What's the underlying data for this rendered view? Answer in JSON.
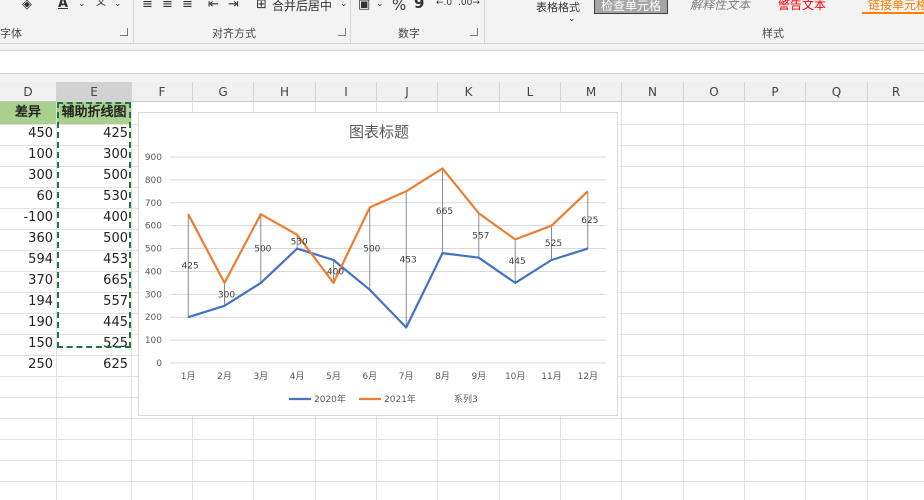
{
  "ribbon": {
    "font_group_label": "字体",
    "align_group_label": "对齐方式",
    "number_group_label": "数字",
    "styles_group_label": "样式",
    "merge_center_label": "合并后居中",
    "table_format_label": "表格格式",
    "percent_label": "%",
    "comma_label": "9",
    "style_items": [
      "检查单元格",
      "解释性文本",
      "警告文本",
      "链接单元格"
    ]
  },
  "columns": [
    "D",
    "E",
    "F",
    "G",
    "H",
    "I",
    "J",
    "K",
    "L",
    "M",
    "N",
    "O",
    "P",
    "Q",
    "R"
  ],
  "table": {
    "header_d": "差异",
    "header_e": "辅助折线图",
    "rows": [
      {
        "d": "450",
        "e": "425"
      },
      {
        "d": "100",
        "e": "300"
      },
      {
        "d": "300",
        "e": "500"
      },
      {
        "d": "60",
        "e": "530"
      },
      {
        "d": "-100",
        "e": "400"
      },
      {
        "d": "360",
        "e": "500"
      },
      {
        "d": "594",
        "e": "453"
      },
      {
        "d": "370",
        "e": "665"
      },
      {
        "d": "194",
        "e": "557"
      },
      {
        "d": "190",
        "e": "445"
      },
      {
        "d": "150",
        "e": "525"
      },
      {
        "d": "250",
        "e": "625"
      }
    ]
  },
  "chart_data": {
    "type": "line",
    "title": "图表标题",
    "categories": [
      "1月",
      "2月",
      "3月",
      "4月",
      "5月",
      "6月",
      "7月",
      "8月",
      "9月",
      "10月",
      "11月",
      "12月"
    ],
    "series": [
      {
        "name": "2020年",
        "color": "#4472c4",
        "values": [
          200,
          250,
          350,
          500,
          450,
          320,
          155,
          480,
          460,
          350,
          450,
          500
        ]
      },
      {
        "name": "2021年",
        "color": "#ed7d31",
        "values": [
          650,
          350,
          650,
          560,
          350,
          680,
          750,
          850,
          654,
          540,
          600,
          750
        ]
      },
      {
        "name": "系列3",
        "color": "none",
        "values": [
          425,
          300,
          500,
          530,
          400,
          500,
          453,
          665,
          557,
          445,
          525,
          625
        ]
      }
    ],
    "series3_labels": [
      "425",
      "300",
      "500",
      "530",
      "400",
      "500",
      "453",
      "665",
      "557",
      "445",
      "525",
      "625"
    ],
    "y_ticks": [
      "0",
      "100",
      "200",
      "300",
      "400",
      "500",
      "600",
      "700",
      "800",
      "900"
    ],
    "ylim": [
      0,
      900
    ],
    "grid": true,
    "legend_position": "bottom"
  }
}
